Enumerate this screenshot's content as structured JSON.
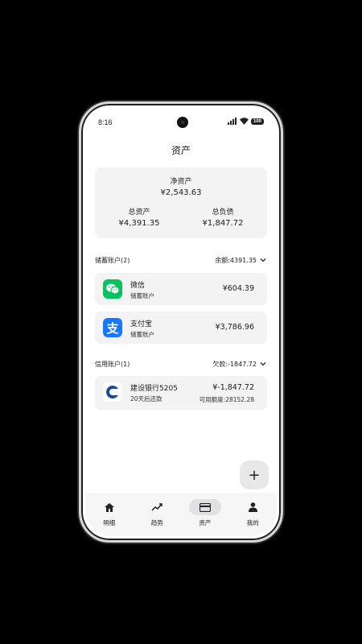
{
  "status": {
    "time": "8:16",
    "battery": "100"
  },
  "header": {
    "title": "资产"
  },
  "summary": {
    "net_label": "净资产",
    "net_value": "¥2,543.63",
    "assets_label": "总资产",
    "assets_value": "¥4,391.35",
    "debts_label": "总负债",
    "debts_value": "¥1,847.72"
  },
  "savings": {
    "title": "储蓄账户(2)",
    "balance": "余额:4391.35",
    "accounts": [
      {
        "name": "微信",
        "type": "储蓄账户",
        "amount": "¥604.39",
        "icon": "wechat-icon",
        "color": "#07c160"
      },
      {
        "name": "支付宝",
        "type": "储蓄账户",
        "amount": "¥3,786.96",
        "icon": "alipay-icon",
        "color": "#1677ff"
      }
    ]
  },
  "credit": {
    "title": "信用账户(1)",
    "owed": "欠款:-1847.72",
    "accounts": [
      {
        "name": "建设银行5205",
        "due": "20天后还款",
        "amount": "¥-1,847.72",
        "available": "可用额度:28152.28",
        "icon": "ccb-bank-icon",
        "color": "#1a4b9b"
      }
    ]
  },
  "fab": {
    "label": "+"
  },
  "nav": [
    {
      "label": "明细",
      "icon": "home-icon"
    },
    {
      "label": "趋势",
      "icon": "trend-icon"
    },
    {
      "label": "资产",
      "icon": "card-icon",
      "active": true
    },
    {
      "label": "我的",
      "icon": "person-icon"
    }
  ]
}
